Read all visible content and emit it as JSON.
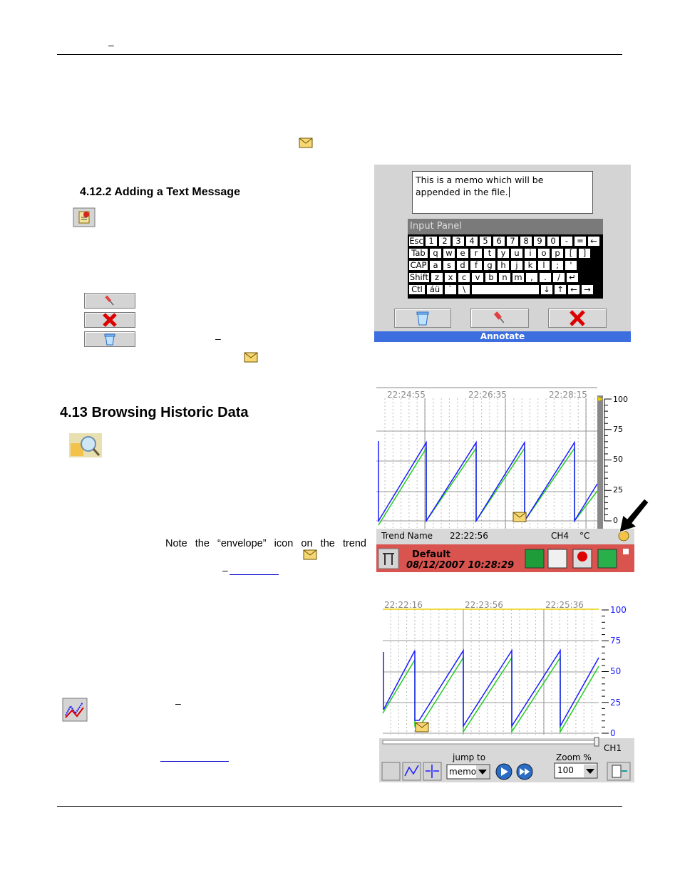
{
  "header": {
    "dash": "–"
  },
  "section_4122": {
    "title": "4.12.2 Adding a Text Message",
    "dash": "–"
  },
  "section_413": {
    "title": "4.13  Browsing Historic Data"
  },
  "body_text": {
    "note_line": "Note  the  “envelope”  icon  on  the  trend",
    "dash1": "–",
    "dash2": "–"
  },
  "annotate_screen": {
    "memo_text": "This is a memo which will be appended in the file.",
    "panel_title": "Input Panel",
    "title_bar": "Annotate",
    "rows": [
      [
        "Esc",
        "1",
        "2",
        "3",
        "4",
        "5",
        "6",
        "7",
        "8",
        "9",
        "0",
        "-",
        "=",
        "←"
      ],
      [
        "Tab",
        "q",
        "w",
        "e",
        "r",
        "t",
        "y",
        "u",
        "i",
        "o",
        "p",
        "[",
        "]"
      ],
      [
        "CAP",
        "a",
        "s",
        "d",
        "f",
        "g",
        "h",
        "j",
        "k",
        "l",
        ";",
        "'"
      ],
      [
        "Shift",
        "z",
        "x",
        "c",
        "v",
        "b",
        "n",
        "m",
        ",",
        ".",
        "/",
        "↵"
      ],
      [
        "Ctl",
        "áü",
        "`",
        "\\",
        "",
        "↓",
        "↑",
        "←",
        "→"
      ]
    ]
  },
  "trend_screen_1": {
    "times": [
      "22:24:55",
      "22:26:35",
      "22:28:15"
    ],
    "scale": [
      "100",
      "75",
      "50",
      "25",
      "0"
    ],
    "status": {
      "name": "Trend Name",
      "time": "22:22:56",
      "channel": "CH4",
      "unit": "°C"
    },
    "footer": {
      "name": "Default",
      "datetime": "08/12/2007 10:28:29"
    }
  },
  "trend_screen_2": {
    "times": [
      "22:22:16",
      "22:23:56",
      "22:25:36"
    ],
    "scale": [
      "100",
      "75",
      "50",
      "25",
      "0"
    ],
    "channel": "CH1",
    "jump_label": "jump to",
    "jump_value": "memo",
    "zoom_label": "Zoom %",
    "zoom_value": "100"
  },
  "colors": {
    "blue_trace": "#1a1aff",
    "green_trace": "#22cc22",
    "footer_red": "#d9534f",
    "title_blue": "#3c6ee0"
  }
}
